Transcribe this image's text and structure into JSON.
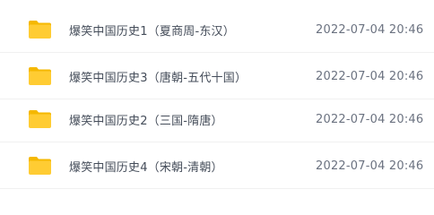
{
  "file_list": {
    "rows": [
      {
        "icon": "folder-icon",
        "name": "爆笑中国历史1（夏商周-东汉）",
        "modified": "2022-07-04 20:46"
      },
      {
        "icon": "folder-icon",
        "name": "爆笑中国历史3（唐朝-五代十国）",
        "modified": "2022-07-04 20:46"
      },
      {
        "icon": "folder-icon",
        "name": "爆笑中国历史2（三国-隋唐）",
        "modified": "2022-07-04 20:46"
      },
      {
        "icon": "folder-icon",
        "name": "爆笑中国历史4（宋朝-清朝）",
        "modified": "2022-07-04 20:46"
      }
    ]
  },
  "colors": {
    "folder_body": "#ffcc33",
    "folder_tab": "#f5b800",
    "name_text": "#454d5a",
    "date_text": "#6b7280"
  }
}
